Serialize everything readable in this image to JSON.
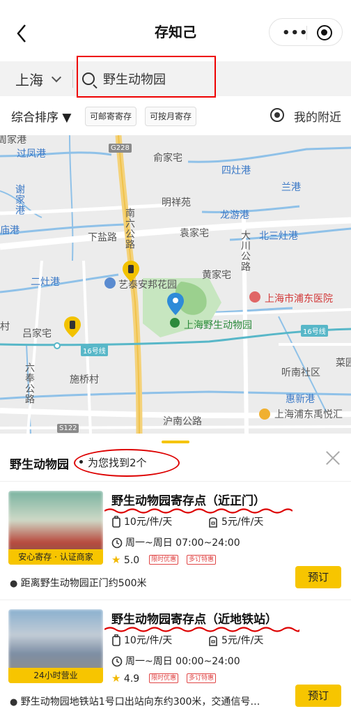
{
  "header": {
    "title": "存知己"
  },
  "search": {
    "city": "上海",
    "query": "野生动物园"
  },
  "filters": {
    "sort": "综合排序 ▼",
    "chip1": "可邮寄寄存",
    "chip2": "可按月寄存",
    "nearby": "我的附近"
  },
  "map": {
    "labels": {
      "guofeng": "过凤港",
      "zhougang": "周家港",
      "caijia": "俞家宅",
      "sizao": "四灶港",
      "lan": "兰港",
      "xiedang": "谢家港",
      "mingxiang": "明祥苑",
      "longyou": "龙游港",
      "yuangang": "庙港",
      "xiayan": "下盐路",
      "yuanjia": "袁家宅",
      "nanliu": "南六公路",
      "dachuan": "大川公路",
      "beisan": "北三灶港",
      "erzao": "二灶港",
      "ailu": "艺泰安邦花园",
      "huangjia": "黄家宅",
      "pudong_hosp": "上海市浦东医院",
      "cun": "村",
      "lvjia": "吕家宅",
      "zoo": "上海野生动物园",
      "line16a": "16号线",
      "line16b": "16号线",
      "liufeng": "六奉公路",
      "shiqiao": "施桥村",
      "tingnan": "听南社区",
      "caiyuan": "菜园",
      "huixin": "惠新港",
      "hunan": "沪南公路",
      "pudong_yue": "上海浦东禹悦汇",
      "g228": "G228",
      "s122": "S122"
    }
  },
  "sheet": {
    "title": "野生动物园",
    "count": "为您找到2个"
  },
  "results": [
    {
      "name": "野生动物园寄存点（近正门）",
      "tag": "安心寄存 · 认证商家",
      "price_bag": "10元/件/天",
      "price_pack": "5元/件/天",
      "hours": "周一~周日 07:00~24:00",
      "rating": "5.0",
      "badge1": "限时优惠",
      "badge2": "多订特惠",
      "address": "距离野生动物园正门约500米",
      "book": "预订"
    },
    {
      "name": "野生动物园寄存点（近地铁站）",
      "tag": "24小时营业",
      "price_bag": "10元/件/天",
      "price_pack": "5元/件/天",
      "hours": "周一~周日 00:00~24:00",
      "rating": "4.9",
      "badge1": "限时优惠",
      "badge2": "多订特惠",
      "address": "野生动物园地铁站1号口出站向东约300米，交通信号…",
      "book": "预订"
    }
  ]
}
